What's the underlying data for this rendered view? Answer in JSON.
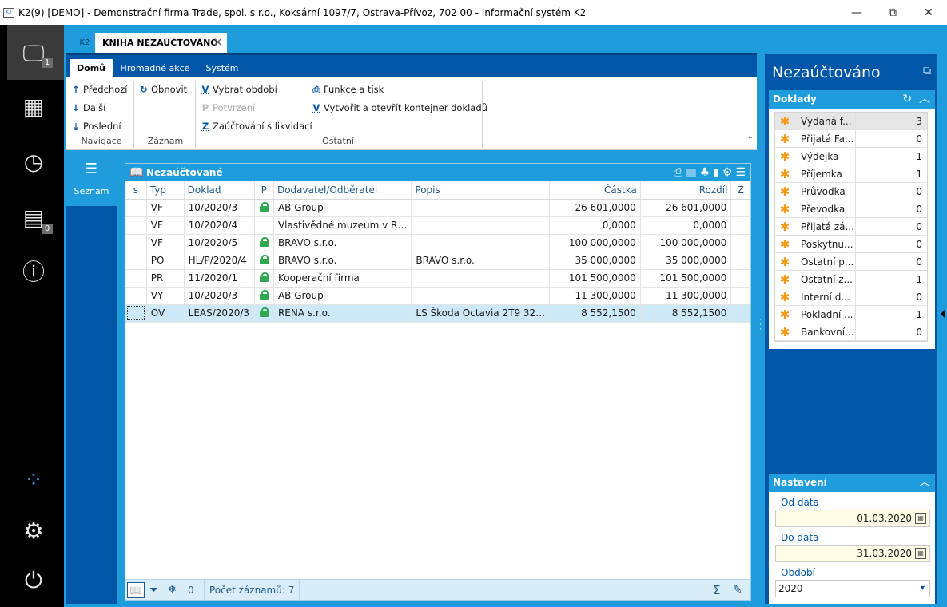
{
  "window": {
    "title": "K2(9) [DEMO] - Demonstrační firma Trade, spol. s r.o., Koksární 1097/7, Ostrava-Přívoz, 702 00 - Informační systém K2",
    "app_logo": "K2",
    "minimize": "—",
    "restore": "⧉",
    "close": "✕"
  },
  "leftbar": {
    "items": [
      {
        "icon": "monitor-icon",
        "glyph": "🖵",
        "badge": "1"
      },
      {
        "icon": "apps-grid-icon",
        "glyph": "▦"
      },
      {
        "icon": "history-icon",
        "glyph": "◷"
      },
      {
        "icon": "messages-icon",
        "glyph": "▤",
        "badge": "0"
      },
      {
        "icon": "info-icon",
        "glyph": "ⓘ"
      },
      {
        "icon": "k2-brand-icon",
        "glyph": "⁘"
      },
      {
        "icon": "settings-icon",
        "glyph": "⚙"
      },
      {
        "icon": "power-icon",
        "glyph": "⏻"
      }
    ]
  },
  "tabs": {
    "k2_label": "K2",
    "active_label": "KNIHA NEZAÚČTOVÁNO",
    "close": "✕"
  },
  "ribbon": {
    "tabs": [
      "Domů",
      "Hromadné akce",
      "Systém"
    ],
    "groups": {
      "navigace": {
        "label": "Navigace",
        "prev": "Předchozí",
        "next": "Další",
        "last": "Poslední"
      },
      "zaznam": {
        "label": "Záznam",
        "refresh": "Obnovit"
      },
      "ostatni": {
        "label": "Ostatní",
        "select_period": "Vybrat období",
        "confirm": "Potvrzení",
        "accounting": "Zaúčtování s likvidací",
        "functions": "Funkce a tisk",
        "container": "Vytvořit a otevřít kontejner dokladů"
      }
    },
    "key_v": "V",
    "key_p": "P",
    "key_z": "Z"
  },
  "dock": {
    "label": "Seznam"
  },
  "grid": {
    "title": "Nezaúčtované",
    "columns": [
      "s",
      "Typ",
      "Doklad",
      "P",
      "Dodavatel/Odběratel",
      "Popis",
      "Částka",
      "Rozdíl",
      "Z"
    ],
    "rows": [
      {
        "typ": "VF",
        "doklad": "10/2020/3",
        "lock": true,
        "partner": "AB Group",
        "popis": "",
        "castka": "26 601,0000",
        "rozdil": "26 601,0000"
      },
      {
        "typ": "VF",
        "doklad": "10/2020/4",
        "lock": false,
        "partner": "Vlastivědné muzeum v R…",
        "popis": "",
        "castka": "0,0000",
        "rozdil": "0,0000"
      },
      {
        "typ": "VF",
        "doklad": "10/2020/5",
        "lock": true,
        "partner": "BRAVO s.r.o.",
        "popis": "",
        "castka": "100 000,0000",
        "rozdil": "100 000,0000"
      },
      {
        "typ": "PO",
        "doklad": "HL/P/2020/4",
        "lock": true,
        "partner": "BRAVO s.r.o.",
        "popis": "BRAVO s.r.o.",
        "castka": "35 000,0000",
        "rozdil": "35 000,0000"
      },
      {
        "typ": "PR",
        "doklad": "11/2020/1",
        "lock": true,
        "partner": "Kooperační firma",
        "popis": "",
        "castka": "101 500,0000",
        "rozdil": "101 500,0000"
      },
      {
        "typ": "VY",
        "doklad": "10/2020/3",
        "lock": true,
        "partner": "AB Group",
        "popis": "",
        "castka": "11 300,0000",
        "rozdil": "11 300,0000"
      },
      {
        "typ": "OV",
        "doklad": "LEAS/2020/3",
        "lock": true,
        "partner": "RENA s.r.o.",
        "popis": "LS Škoda Octavia 2T9 32…",
        "castka": "8 552,1500",
        "rozdil": "8 552,1500",
        "selected": true
      }
    ],
    "footer": {
      "filter_count": "0",
      "records_label": "Počet záznamů: 7"
    }
  },
  "right_panel": {
    "title": "Nezaúčtováno",
    "doklady": {
      "header": "Doklady",
      "items": [
        {
          "name": "Vydaná f...",
          "count": "3",
          "selected": true
        },
        {
          "name": "Přijatá Fa...",
          "count": "0"
        },
        {
          "name": "Výdejka",
          "count": "1"
        },
        {
          "name": "Příjemka",
          "count": "1"
        },
        {
          "name": "Průvodka",
          "count": "0"
        },
        {
          "name": "Převodka",
          "count": "0"
        },
        {
          "name": "Přijatá zá...",
          "count": "0"
        },
        {
          "name": "Poskytnu...",
          "count": "0"
        },
        {
          "name": "Ostatní p...",
          "count": "0"
        },
        {
          "name": "Ostatní z...",
          "count": "1"
        },
        {
          "name": "Interní d...",
          "count": "0"
        },
        {
          "name": "Pokladní ...",
          "count": "1"
        },
        {
          "name": "Bankovní...",
          "count": "0"
        }
      ]
    },
    "nastaveni": {
      "header": "Nastavení",
      "od_label": "Od data",
      "od_value": "01.03.2020",
      "do_label": "Do data",
      "do_value": "31.03.2020",
      "obdobi_label": "Období",
      "obdobi_value": "2020"
    }
  },
  "colors": {
    "accent": "#1e9cdb",
    "dark_blue": "#0057a8",
    "sidebar": "#000000",
    "lock_green": "#2fa84f",
    "star_orange": "#f59a1b",
    "selected_row": "#cde8f6"
  }
}
